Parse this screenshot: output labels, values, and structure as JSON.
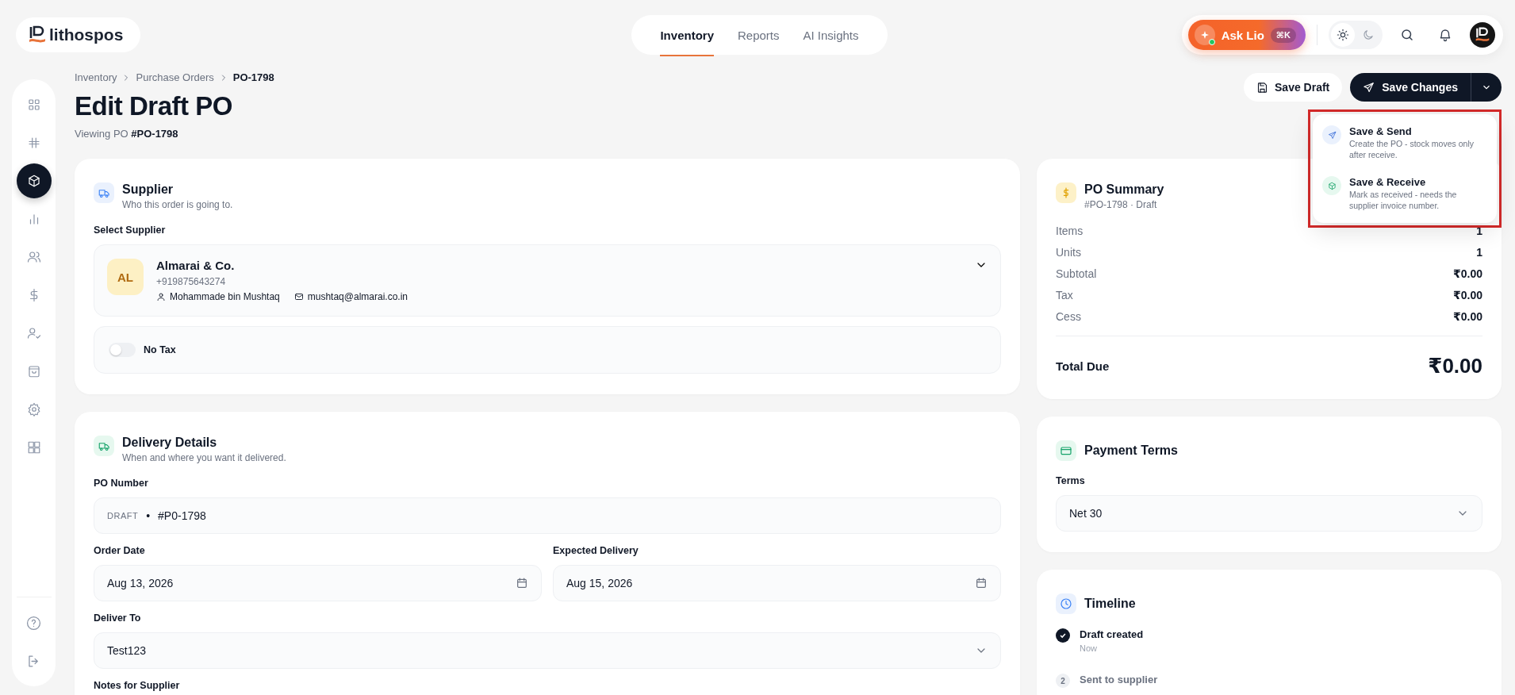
{
  "brand": {
    "name": "lithospos"
  },
  "nav": [
    {
      "label": "Inventory",
      "selected": true
    },
    {
      "label": "Reports",
      "selected": false
    },
    {
      "label": "AI Insights",
      "selected": false
    }
  ],
  "assistant": {
    "label": "Ask Lio",
    "shortcut": "⌘K"
  },
  "theme_toggle": [
    {
      "kind": "sun",
      "selected": true
    },
    {
      "kind": "moon",
      "selected": false
    }
  ],
  "sidebar": {
    "items": [
      {
        "selected": false
      },
      {
        "selected": false
      },
      {
        "selected": true
      },
      {
        "selected": false
      },
      {
        "selected": false
      },
      {
        "selected": false
      },
      {
        "selected": false
      },
      {
        "selected": false
      },
      {
        "selected": false
      },
      {
        "selected": false
      }
    ]
  },
  "breadcrumbs": [
    "Inventory",
    "Purchase Orders",
    "PO-1798"
  ],
  "page": {
    "title": "Edit Draft PO",
    "subtitle": "Viewing PO **#PO-1798**"
  },
  "actions": {
    "save_draft": "Save Draft",
    "save_changes": "Save Changes",
    "menu": [
      {
        "kind": "send",
        "title": "Save & Send",
        "description": "Create the PO - stock moves only after receive."
      },
      {
        "kind": "receive",
        "title": "Save & Receive",
        "description": "Mark as received - needs the supplier invoice number."
      }
    ]
  },
  "supplier_card": {
    "title": "Supplier",
    "subtitle": "Who this order is going to.",
    "field_label": "Select Supplier",
    "supplier": {
      "initials": "AL",
      "name": "Almarai & Co.",
      "phone": "+919875643274",
      "contact": "Mohammade bin Mushtaq",
      "email": "mushtaq@almarai.co.in"
    },
    "no_tax": {
      "label": "No Tax",
      "on": false
    }
  },
  "delivery_card": {
    "title": "Delivery Details",
    "subtitle": "When and where you want it delivered.",
    "po_number": {
      "label": "PO Number",
      "prefix": "DRAFT",
      "separator": "•",
      "value": "#P0-1798"
    },
    "order_date": {
      "label": "Order Date",
      "value": "Aug 13, 2026"
    },
    "expected_delivery": {
      "label": "Expected Delivery",
      "value": "Aug 15, 2026"
    },
    "deliver_to": {
      "label": "Deliver To",
      "value": "Test123"
    },
    "notes_label": "Notes for Supplier"
  },
  "summary": {
    "title": "PO Summary",
    "subtitle": "#PO-1798 · Draft",
    "rows": [
      {
        "label": "Items",
        "value": "1"
      },
      {
        "label": "Units",
        "value": "1"
      },
      {
        "label": "Subtotal",
        "value": "₹0.00"
      },
      {
        "label": "Tax",
        "value": "₹0.00"
      },
      {
        "label": "Cess",
        "value": "₹0.00"
      }
    ],
    "total": {
      "label": "Total Due",
      "value": "₹0.00"
    }
  },
  "payment": {
    "title": "Payment Terms",
    "terms_label": "Terms",
    "value": "Net 30"
  },
  "timeline": {
    "title": "Timeline",
    "steps": [
      {
        "title": "Draft created",
        "time": "Now",
        "done": true
      },
      {
        "title": "Sent to supplier",
        "number": "2",
        "done": false
      }
    ]
  }
}
